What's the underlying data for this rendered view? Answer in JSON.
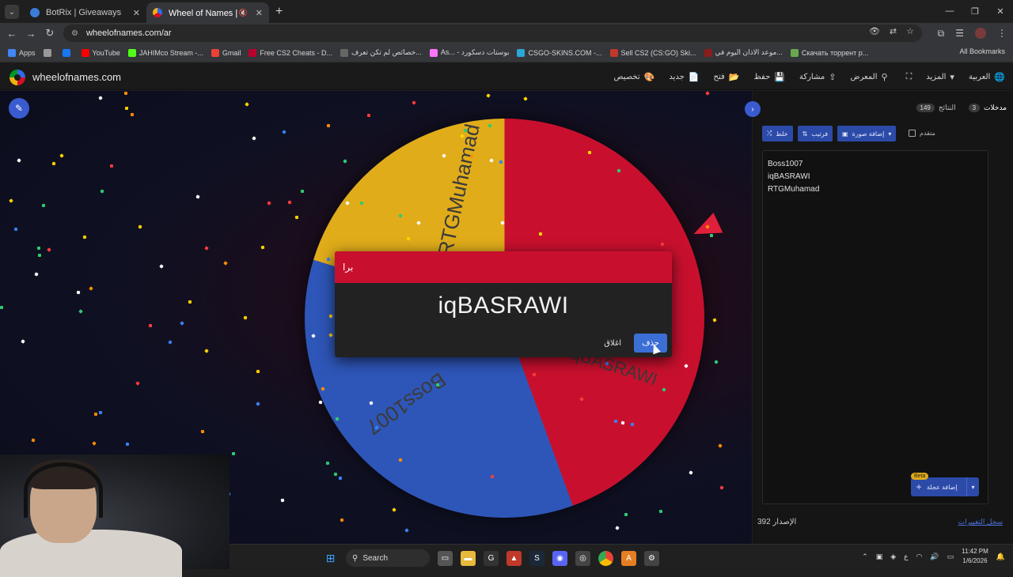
{
  "browser": {
    "tabs": [
      {
        "title": "BotRix | Giveaways",
        "active": false,
        "favicon_color": "#3d7bd9"
      },
      {
        "title": "Wheel of Names | العشوائي",
        "active": true,
        "favicon_color": "#e0ac1a"
      }
    ],
    "url": "wheelofnames.com/ar",
    "bookmarks": [
      {
        "label": "Apps",
        "color": "#4285f4"
      },
      {
        "label": "",
        "color": "#999999"
      },
      {
        "label": "",
        "color": "#1877f2"
      },
      {
        "label": "YouTube",
        "color": "#ff0000"
      },
      {
        "label": "JAHIMco Stream -...",
        "color": "#53fc18"
      },
      {
        "label": "Gmail",
        "color": "#ea4335"
      },
      {
        "label": "Free CS2 Cheats - D...",
        "color": "#b8002e"
      },
      {
        "label": "خصائص لم تكن تعرف...",
        "color": "#666666"
      },
      {
        "label": "As... - بوستات دسكورد",
        "color": "#ff73fa"
      },
      {
        "label": "CSGO-SKINS.COM -...",
        "color": "#2aa7d6"
      },
      {
        "label": "Sell CS2 (CS:GO) Ski...",
        "color": "#c0392b"
      },
      {
        "label": "موعد الاذان اليوم في...",
        "color": "#8a1c1c"
      },
      {
        "label": "Скачать торрент р...",
        "color": "#6aa84f"
      }
    ],
    "all_bookmarks": "All Bookmarks"
  },
  "site": {
    "brand": "wheelofnames.com",
    "nav": [
      {
        "label": "العربية",
        "icon": "globe-icon",
        "glyph": "🌐"
      },
      {
        "label": "المزيد",
        "icon": "chevron-down-icon",
        "glyph": "▾"
      },
      {
        "label": "",
        "icon": "fullscreen-icon",
        "glyph": "⛶"
      },
      {
        "label": "المعرض",
        "icon": "search-icon",
        "glyph": "⚲"
      },
      {
        "label": "مشاركة",
        "icon": "share-icon",
        "glyph": "⇪"
      },
      {
        "label": "حفظ",
        "icon": "save-icon",
        "glyph": "💾"
      },
      {
        "label": "فتح",
        "icon": "folder-icon",
        "glyph": "📂"
      },
      {
        "label": "جديد",
        "icon": "new-file-icon",
        "glyph": "📄"
      },
      {
        "label": "تخصيص",
        "icon": "palette-icon",
        "glyph": "🎨"
      }
    ],
    "wheel_labels": [
      "RTGMuhamad",
      "Boss1007",
      "iqBASRAWI"
    ],
    "modal": {
      "title": "برا",
      "winner": "iqBASRAWI",
      "close_label": "اغلاق",
      "remove_label": "حذف"
    },
    "panel": {
      "tab_entries": "مدخلات",
      "tab_entries_count": "3",
      "tab_results": "النتائج",
      "tab_results_count": "149",
      "shuffle_label": "خلط",
      "sort_label": "فرتيب",
      "add_image_label": "إضافة صورة",
      "advanced_label": "متقدم",
      "entries": [
        "Boss1007",
        "iqBASRAWI",
        "RTGMuhamad"
      ],
      "add_wheel_label": "إضافة عجلة",
      "beta": "Beta",
      "version_label": "الإصدار",
      "version_number": "392",
      "changelog": "سجل التغييرات"
    }
  },
  "taskbar": {
    "search_label": "Search",
    "time": "11:42 PM",
    "date": "1/6/2026",
    "lang": "ع"
  }
}
